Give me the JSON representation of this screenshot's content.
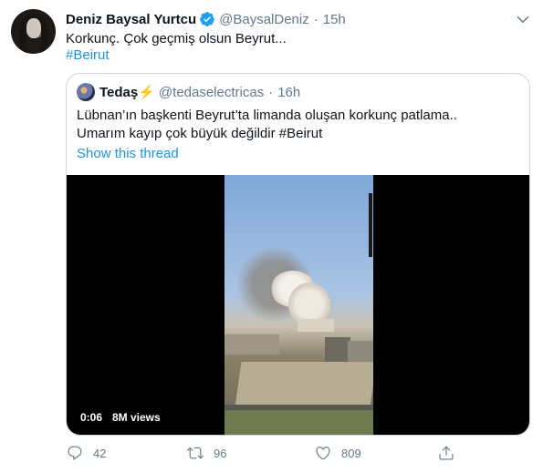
{
  "tweet": {
    "author_name": "Deniz Baysal Yurtcu",
    "handle": "@BaysalDeniz",
    "separator": "·",
    "time": "15h",
    "text": "Korkunç. Çok geçmiş olsun Beyrut...",
    "hashtag": "#Beirut",
    "icons": {
      "verified": "verified-badge-icon",
      "more": "chevron-down-icon"
    },
    "colors": {
      "accent": "#1b95e0",
      "verified": "#1da1f2",
      "muted": "#657786"
    }
  },
  "quote": {
    "author_name": "Tedaş⚡",
    "handle": "@tedaselectricas",
    "separator": "·",
    "time": "16h",
    "text_line1": "Lübnan’ın başkenti Beyrut’ta limanda oluşan korkunç patlama..",
    "text_line2": "Umarım kayıp çok büyük değildir #Beirut",
    "show_thread": "Show this thread",
    "video": {
      "duration": "0:06",
      "views": "8M views"
    }
  },
  "actions": {
    "reply_count": "42",
    "retweet_count": "96",
    "like_count": "809",
    "icons": [
      "reply-icon",
      "retweet-icon",
      "like-icon",
      "share-icon"
    ]
  }
}
